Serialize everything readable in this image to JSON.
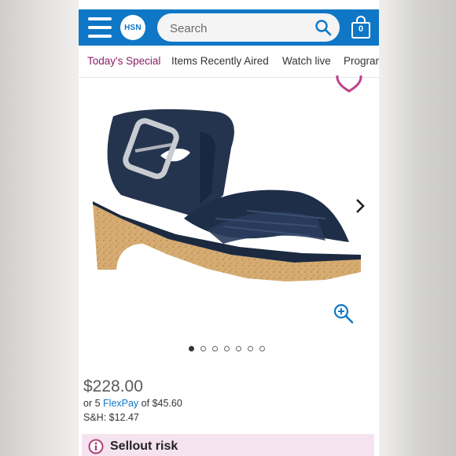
{
  "header": {
    "logo_text": "HSN",
    "search_placeholder": "Search",
    "cart_count": "0",
    "brand_color": "#0f77c6"
  },
  "nav": {
    "items": [
      {
        "label": "Today's Special",
        "active": true
      },
      {
        "label": "Items Recently Aired",
        "active": false
      },
      {
        "label": "Watch live",
        "active": false
      },
      {
        "label": "Programs",
        "active": false
      }
    ]
  },
  "product": {
    "image_description": "navy suede cork-wedge sandal with silver buckle",
    "gallery": {
      "image_count": 7,
      "active_index": 0
    },
    "price": "$228.00",
    "flexpay": {
      "prefix": "or 5",
      "link": "FlexPay",
      "suffix": "of $45.60"
    },
    "shipping": "S&H: $12.47"
  },
  "alert": {
    "label": "Sellout risk",
    "accent_color": "#b0407d"
  },
  "icons": [
    "menu-icon",
    "search-icon",
    "shopping-bag-icon",
    "heart-icon",
    "chevron-right-icon",
    "zoom-in-icon",
    "info-icon"
  ]
}
